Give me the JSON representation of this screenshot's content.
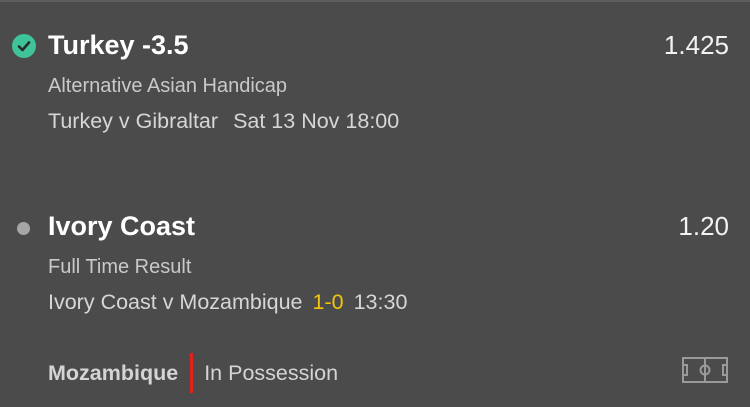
{
  "bets": [
    {
      "status": "won",
      "status_icon": "check-circle-icon",
      "selection": "Turkey -3.5",
      "odds": "1.425",
      "market": "Alternative Asian Handicap",
      "event": "Turkey v Gibraltar",
      "date_time": "Sat 13 Nov 18:00"
    },
    {
      "status": "pending",
      "status_icon": "pending-dot-icon",
      "selection": "Ivory Coast",
      "odds": "1.20",
      "market": "Full Time Result",
      "event": "Ivory Coast v Mozambique",
      "score": "1-0",
      "time": "13:30",
      "possession_team": "Mozambique",
      "possession_text": "In Possession",
      "pitch_icon": "football-pitch-icon"
    }
  ],
  "colors": {
    "background": "#4b4b4b",
    "won_green": "#3fc39a",
    "score_yellow": "#f1c40f",
    "possession_red": "#e2231a"
  }
}
